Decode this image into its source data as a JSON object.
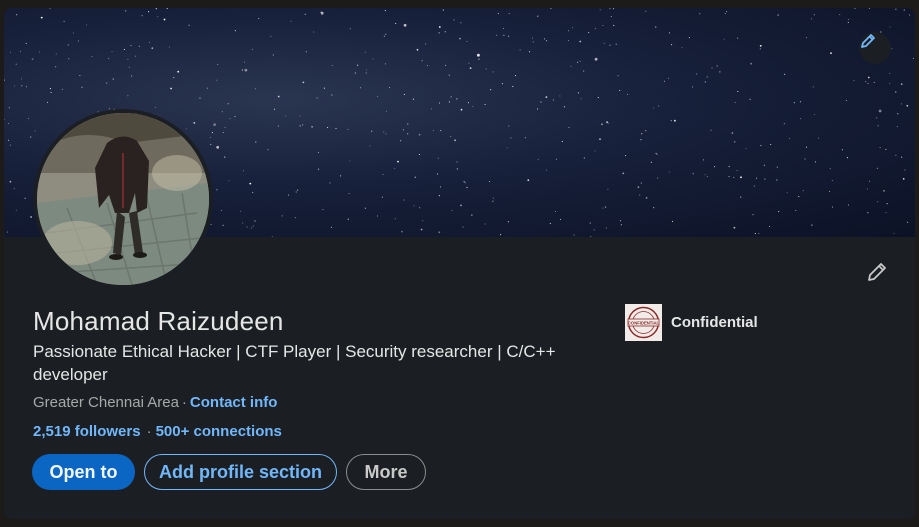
{
  "profile": {
    "name": "Mohamad Raizudeen",
    "headline": "Passionate Ethical Hacker | CTF Player | Security researcher | C/C++ developer",
    "location": "Greater Chennai Area",
    "location_separator": "·",
    "contact_info_label": "Contact info",
    "followers": "2,519 followers",
    "network_separator": "·",
    "connections": "500+ connections"
  },
  "company": {
    "name": "Confidential",
    "logo_text": "CONFIDENTIAL"
  },
  "buttons": {
    "open_to": "Open to",
    "add_section": "Add profile section",
    "more": "More"
  },
  "icons": {
    "banner_edit": "pencil-icon",
    "profile_edit": "pencil-icon"
  },
  "colors": {
    "card_bg": "#1b1f23",
    "accent_blue": "#0a66c2",
    "link_blue": "#71b7fb",
    "text_primary": "#e6e6e6",
    "text_secondary": "#a8a8a8"
  }
}
